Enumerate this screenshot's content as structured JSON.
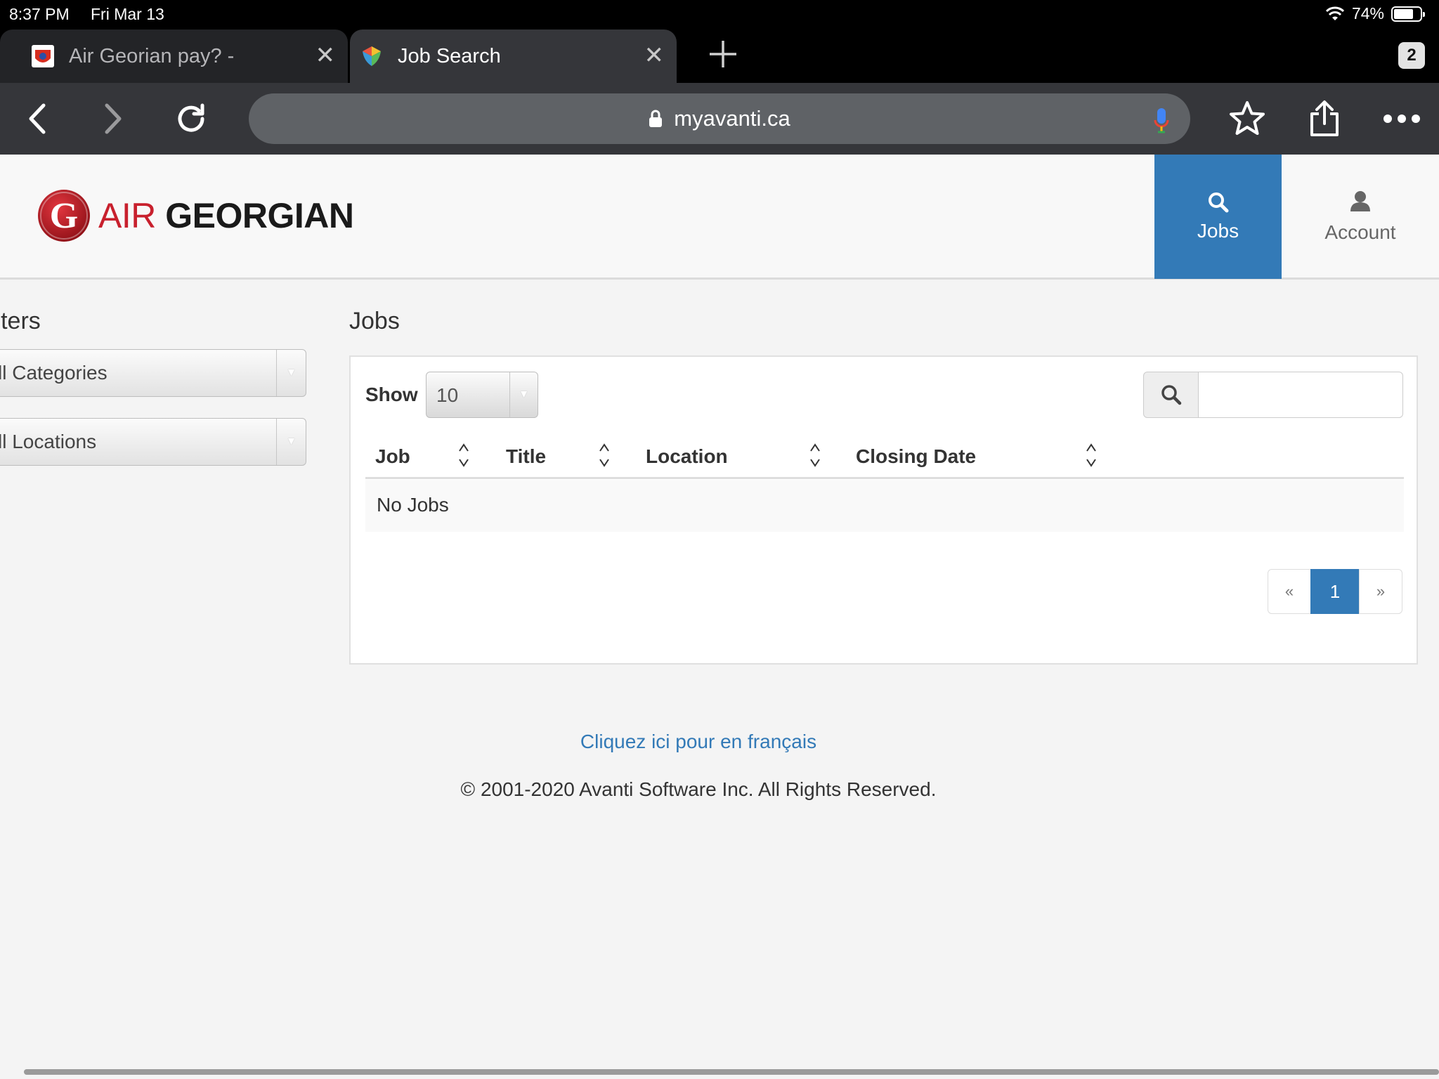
{
  "status_bar": {
    "time": "8:37 PM",
    "date": "Fri Mar 13",
    "battery": "74%",
    "battery_level": 0.74
  },
  "browser": {
    "tabs": [
      {
        "title": "Air Georian pay? -",
        "active": false
      },
      {
        "title": "Job Search",
        "active": true
      }
    ],
    "tab_count": "2",
    "url": "myavanti.ca"
  },
  "header": {
    "logo_air": "AIR",
    "logo_georgian": "GEORGIAN",
    "nav": {
      "jobs": "Jobs",
      "account": "Account"
    }
  },
  "filters": {
    "title": "ilters",
    "categories": "ll Categories",
    "locations": "ll Locations"
  },
  "jobs": {
    "title": "Jobs",
    "show_label": "Show",
    "show_value": "10",
    "search_value": "",
    "columns": [
      "Job",
      "Title",
      "Location",
      "Closing Date"
    ],
    "empty_message": "No Jobs",
    "pagination": {
      "prev": "«",
      "current": "1",
      "next": "»"
    }
  },
  "footer": {
    "lang_link": "Cliquez ici pour en français",
    "copyright": "© 2001-2020 Avanti Software Inc. All Rights Reserved."
  },
  "colors": {
    "brand_red": "#c8202d",
    "accent_blue": "#337ab7",
    "chrome_dark": "#35363a"
  }
}
